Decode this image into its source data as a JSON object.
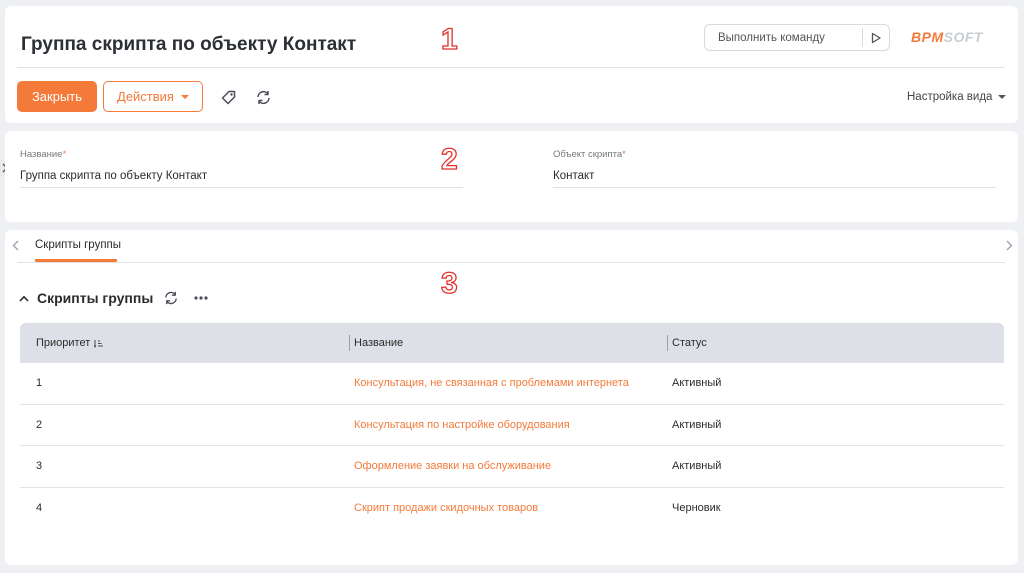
{
  "header": {
    "title": "Группа скрипта по объекту Контакт",
    "marker": "1",
    "command_placeholder": "Выполнить команду",
    "logo_part1": "BPM",
    "logo_part2": "SOFT",
    "close_label": "Закрыть",
    "actions_label": "Действия",
    "view_settings_label": "Настройка вида",
    "icons": [
      "tag-icon",
      "refresh-icon",
      "play-icon"
    ]
  },
  "info": {
    "marker": "2",
    "name_label": "Название",
    "name_value": "Группа скрипта по объекту Контакт",
    "object_label": "Объект скрипта",
    "object_value": "Контакт",
    "required_mark": "*"
  },
  "detail": {
    "marker": "3",
    "tab_label": "Скрипты группы",
    "section_title": "Скрипты группы",
    "columns": {
      "priority": "Приоритет",
      "name": "Название",
      "status": "Статус"
    },
    "rows": [
      {
        "priority": "1",
        "name": "Консультация, не связанная с проблемами интернета",
        "status": "Активный"
      },
      {
        "priority": "2",
        "name": "Консультация по настройке оборудования",
        "status": "Активный"
      },
      {
        "priority": "3",
        "name": "Оформление заявки на обслуживание",
        "status": "Активный"
      },
      {
        "priority": "4",
        "name": "Скрипт продажи скидочных товаров",
        "status": "Черновик"
      }
    ]
  },
  "colors": {
    "accent": "#f47a3a",
    "marker": "#e0312b",
    "grid_header": "#dde0e6"
  }
}
